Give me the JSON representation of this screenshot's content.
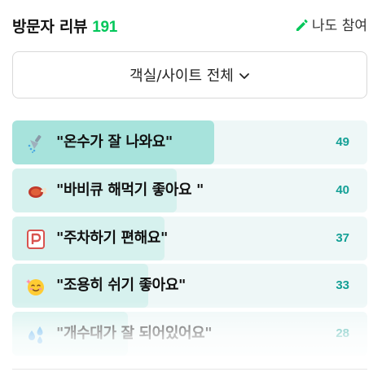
{
  "header": {
    "title": "방문자 리뷰",
    "count": "191",
    "join_label": "나도 참여"
  },
  "filter": {
    "label": "객실/사이트 전체"
  },
  "reviews": [
    {
      "icon": "shower-icon",
      "label": "\"온수가 잘 나와요\"",
      "count": "49",
      "share": 1.0
    },
    {
      "icon": "bbq-meat-icon",
      "label": "\"바비큐 해먹기 좋아요 \"",
      "count": "40",
      "share": 0.816
    },
    {
      "icon": "parking-icon",
      "label": "\"주차하기 편해요\"",
      "count": "37",
      "share": 0.755
    },
    {
      "icon": "smiling-face-icon",
      "label": "\"조용히 쉬기 좋아요\"",
      "count": "33",
      "share": 0.673
    },
    {
      "icon": "water-drops-icon",
      "label": "\"개수대가 잘 되어있어요\"",
      "count": "28",
      "share": 0.571
    }
  ],
  "colors": {
    "accent_green": "#03c75a",
    "count_teal": "#14a096",
    "bar_fill_top": "#a7e3dc",
    "bar_fill": "#d6f1ee",
    "bar_track": "#eef7f7"
  }
}
